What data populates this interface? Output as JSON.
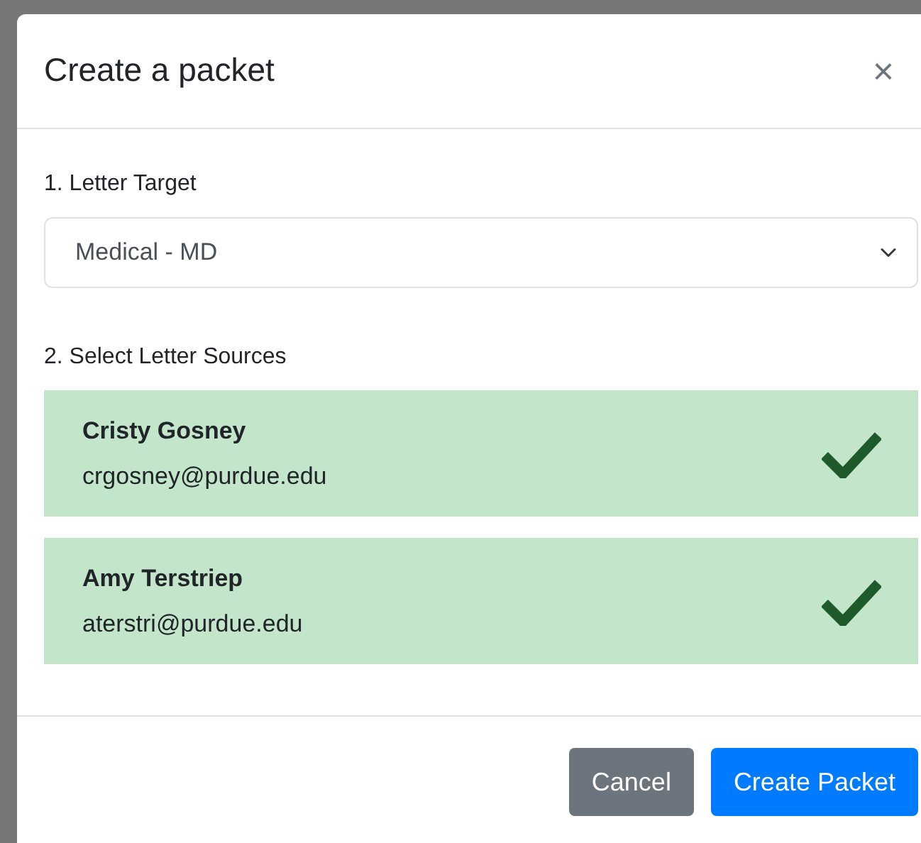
{
  "modal": {
    "title": "Create a packet",
    "close": "×"
  },
  "target": {
    "label": "1. Letter Target",
    "value": "Medical - MD"
  },
  "sources_label": "2. Select Letter Sources",
  "sources": [
    {
      "name": "Cristy Gosney",
      "email": "crgosney@purdue.edu",
      "selected": true
    },
    {
      "name": "Amy Terstriep",
      "email": "aterstri@purdue.edu",
      "selected": true
    }
  ],
  "buttons": [
    {
      "label": "Cancel",
      "kind": "secondary"
    },
    {
      "label": "Create Packet",
      "kind": "primary"
    }
  ]
}
